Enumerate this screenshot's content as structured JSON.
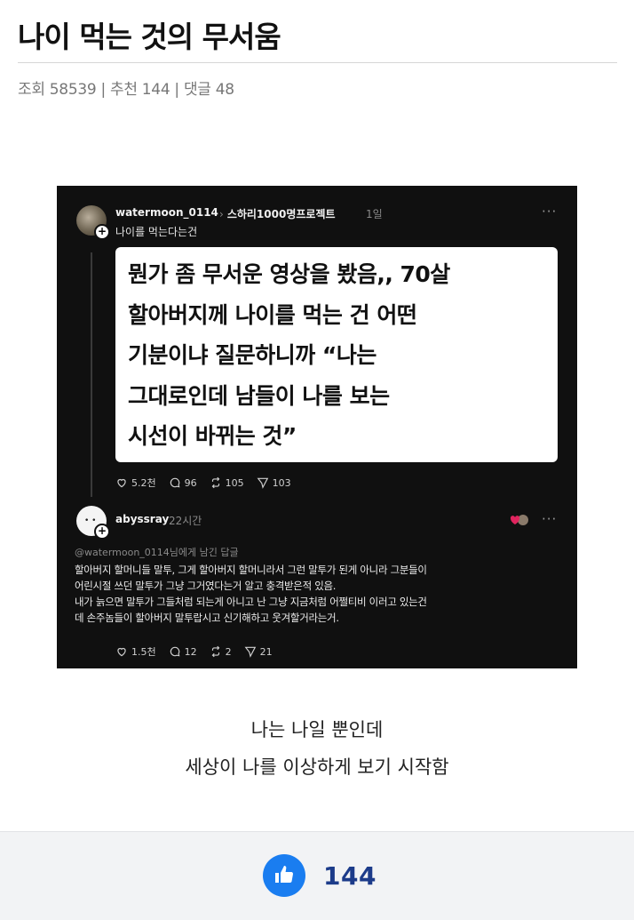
{
  "post": {
    "title": "나이 먹는 것의 무서움",
    "meta": "조회 58539 | 추천 144 | 댓글 48"
  },
  "screenshot": {
    "post1": {
      "username": "watermoon_0114",
      "topic": "스하리1000명프로젝트",
      "time": "1일",
      "caption": "나이를 먹는다는건",
      "card_lines": [
        "뭔가 좀 무서운 영상을 봤음,, 70살",
        "할아버지께 나이를 먹는 건 어떤",
        "기분이냐 질문하니까 “나는",
        "그대로인데 남들이 나를 보는",
        "시선이 바뀌는 것”"
      ],
      "likes": "5.2천",
      "comments": "96",
      "reposts": "105",
      "shares": "103"
    },
    "post2": {
      "username": "abyssray",
      "time": "22시간",
      "reply_to": "@watermoon_0114님에게 남긴 답글",
      "body_lines": [
        "할아버지 할머니들 말투, 그게 할아버지 할머니라서 그런 말투가 된게 아니라 그분들이",
        "어린시절 쓰던 말투가 그냥 그거였다는거 알고 충격받은적 있음.",
        "내가 늙으면 말투가 그들처럼 되는게 아니고 난 그냥 지금처럼 어쩔티비 이러고 있는건",
        "데 손주놈들이 할아버지 말투랍시고 신기해하고 웃겨할거라는거."
      ],
      "likes": "1.5천",
      "comments": "12",
      "reposts": "2",
      "shares": "21"
    }
  },
  "post_text": {
    "line1": "나는 나일 뿐인데",
    "line2": "세상이 나를 이상하게 보기 시작함"
  },
  "footer": {
    "like_count": "144"
  },
  "colors": {
    "accent": "#1a7df0",
    "count": "#1c3b8a"
  }
}
